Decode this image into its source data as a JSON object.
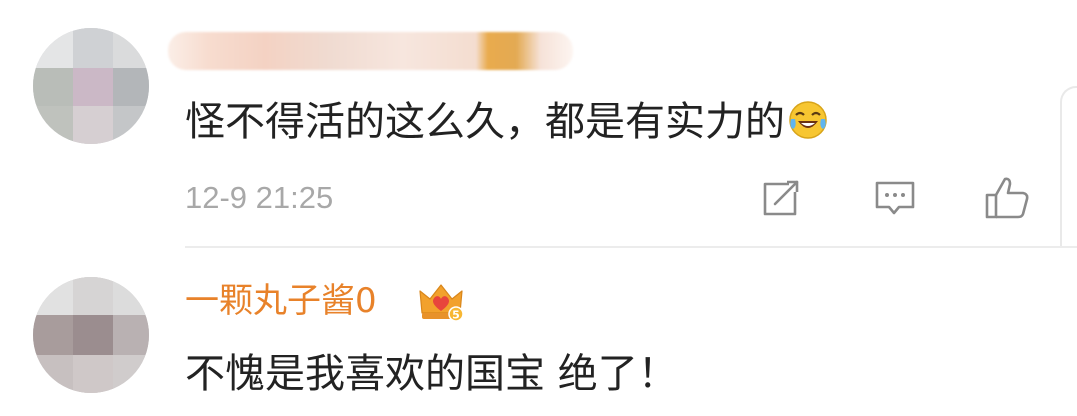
{
  "comments": [
    {
      "username": "",
      "text": "怪不得活的这么久，都是有实力的",
      "emoji": "laugh-cry-emoji",
      "timestamp": "12-9 21:25",
      "actions": [
        "share-icon",
        "reply-icon",
        "like-icon"
      ]
    },
    {
      "username": "一颗丸子酱0",
      "badge": "crown-level-badge",
      "badge_level": "5",
      "text": "不愧是我喜欢的国宝 绝了！"
    }
  ],
  "colors": {
    "username": "#e8822a",
    "text": "#222222",
    "meta": "#a8a8a8",
    "icon": "#8a8a8a",
    "crown": "#f2a12c",
    "heart": "#e8453c"
  }
}
